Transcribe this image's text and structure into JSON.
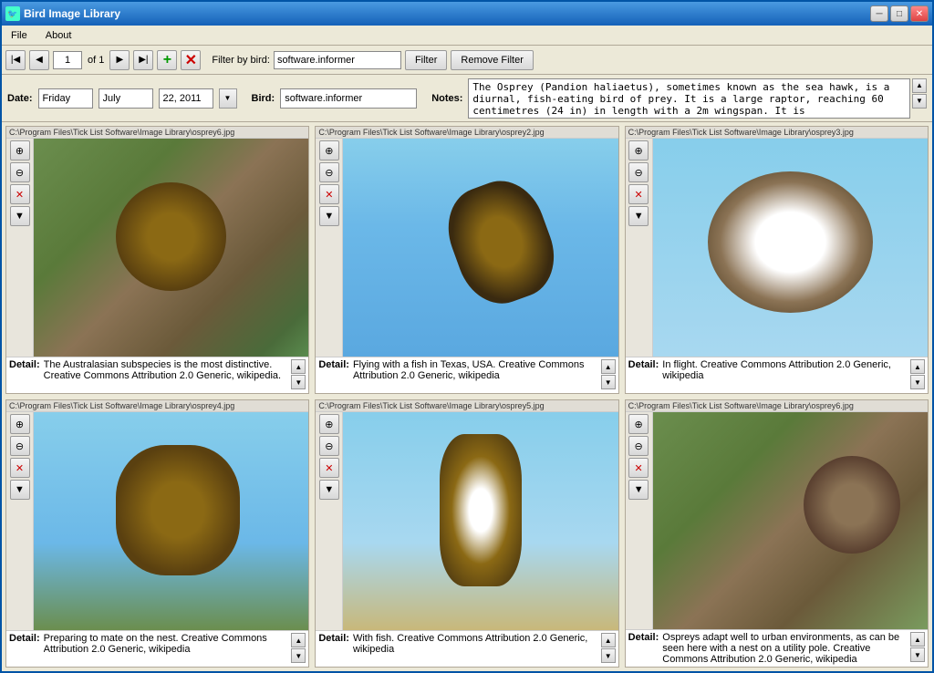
{
  "window": {
    "title": "Bird Image Library",
    "minimize": "─",
    "maximize": "□",
    "close": "✕"
  },
  "menu": {
    "file": "File",
    "about": "About"
  },
  "toolbar": {
    "page_value": "1",
    "page_of": "of 1",
    "add_label": "+",
    "delete_label": "✕",
    "filter_label": "Filter by bird:",
    "filter_value": "software.informer",
    "filter_button": "Filter",
    "remove_filter_button": "Remove Filter"
  },
  "info": {
    "date_label": "Date:",
    "date_day": "Friday",
    "date_month": "July",
    "date_year": "22, 2011",
    "bird_label": "Bird:",
    "bird_value": "software.informer",
    "notes_label": "Notes:",
    "notes_text": "The Osprey (Pandion haliaetus), sometimes known as the sea hawk, is a diurnal, fish-eating bird of prey. It is a large raptor, reaching 60 centimetres (24 in) in length with a 2m wingspan. It is"
  },
  "images": [
    {
      "path": "C:\\Program Files\\Tick List Software\\Image Library\\osprey6.jpg",
      "detail": "The Australasian subspecies is the most distinctive. Creative Commons Attribution 2.0 Generic, wikipedia.",
      "type": "nest"
    },
    {
      "path": "C:\\Program Files\\Tick List Software\\Image Library\\osprey2.jpg",
      "detail": "Flying with a fish in Texas, USA. Creative Commons Attribution 2.0 Generic, wikipedia",
      "type": "flying"
    },
    {
      "path": "C:\\Program Files\\Tick List Software\\Image Library\\osprey3.jpg",
      "detail": "In flight. Creative Commons Attribution 2.0 Generic, wikipedia",
      "type": "inflight"
    },
    {
      "path": "C:\\Program Files\\Tick List Software\\Image Library\\osprey4.jpg",
      "detail": "Preparing to mate on the nest. Creative Commons Attribution 2.0 Generic, wikipedia",
      "type": "nest2"
    },
    {
      "path": "C:\\Program Files\\Tick List Software\\Image Library\\osprey5.jpg",
      "detail": "With fish. Creative Commons Attribution 2.0 Generic, wikipedia",
      "type": "withfish"
    },
    {
      "path": "C:\\Program Files\\Tick List Software\\Image Library\\osprey6.jpg",
      "detail": "Ospreys adapt well to urban environments, as can be seen here with a nest on a utility pole. Creative Commons Attribution 2.0 Generic, wikipedia",
      "type": "urban"
    }
  ],
  "controls": {
    "zoom_in": "🔍",
    "zoom_out": "🔍",
    "delete": "✕",
    "arrow_down": "▼"
  }
}
